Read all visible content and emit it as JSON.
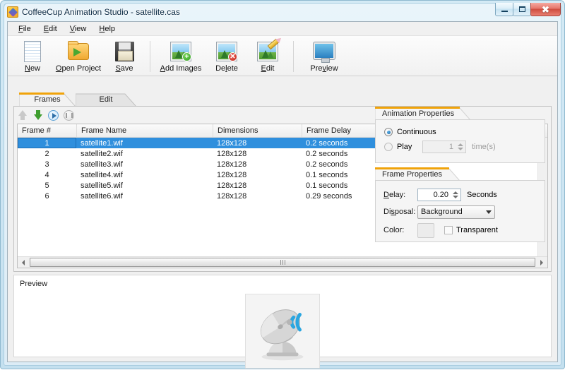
{
  "window": {
    "title": "CoffeeCup Animation Studio - satellite.cas",
    "app_icon": "coffeecup-app-icon",
    "buttons": {
      "minimize": "–",
      "maximize": "□",
      "close": "✕"
    }
  },
  "menu": {
    "items": [
      {
        "label": "File",
        "accel": "F"
      },
      {
        "label": "Edit",
        "accel": "E"
      },
      {
        "label": "View",
        "accel": "V"
      },
      {
        "label": "Help",
        "accel": "H"
      }
    ]
  },
  "toolbar": {
    "buttons": [
      {
        "label": "New",
        "accel": "N",
        "icon": "new-document-icon"
      },
      {
        "label": "Open Project",
        "accel": "O",
        "icon": "open-folder-icon"
      },
      {
        "label": "Save",
        "accel": "S",
        "icon": "floppy-disk-icon"
      },
      {
        "label": "Add Images",
        "accel": "A",
        "icon": "add-image-icon"
      },
      {
        "label": "Delete",
        "accel": "l",
        "icon": "delete-image-icon"
      },
      {
        "label": "Edit",
        "accel": "E",
        "icon": "edit-image-icon"
      },
      {
        "label": "Preview",
        "accel": "v",
        "icon": "monitor-preview-icon"
      }
    ]
  },
  "tabs": [
    {
      "label": "Frames",
      "active": true
    },
    {
      "label": "Edit",
      "active": false
    }
  ],
  "list_tools": [
    {
      "name": "move-up-button",
      "icon": "arrow-up-icon",
      "enabled": false
    },
    {
      "name": "move-down-button",
      "icon": "arrow-down-icon",
      "enabled": true
    },
    {
      "name": "play-button",
      "icon": "play-icon",
      "enabled": true
    },
    {
      "name": "pause-button",
      "icon": "pause-icon",
      "enabled": false
    }
  ],
  "frame_list": {
    "columns": [
      "Frame #",
      "Frame Name",
      "Dimensions",
      "Frame Delay"
    ],
    "rows": [
      {
        "num": "1",
        "name": "satellite1.wif",
        "dimensions": "128x128",
        "delay": "0.2 seconds",
        "selected": true
      },
      {
        "num": "2",
        "name": "satellite2.wif",
        "dimensions": "128x128",
        "delay": "0.2 seconds",
        "selected": false
      },
      {
        "num": "3",
        "name": "satellite3.wif",
        "dimensions": "128x128",
        "delay": "0.2 seconds",
        "selected": false
      },
      {
        "num": "4",
        "name": "satellite4.wif",
        "dimensions": "128x128",
        "delay": "0.1 seconds",
        "selected": false
      },
      {
        "num": "5",
        "name": "satellite5.wif",
        "dimensions": "128x128",
        "delay": "0.1 seconds",
        "selected": false
      },
      {
        "num": "6",
        "name": "satellite6.wif",
        "dimensions": "128x128",
        "delay": "0.29 seconds",
        "selected": false
      }
    ]
  },
  "animation_properties": {
    "title": "Animation Properties",
    "continuous_label": "Continuous",
    "continuous_selected": true,
    "play_label": "Play",
    "play_selected": false,
    "play_count": "1",
    "times_label": "time(s)"
  },
  "frame_properties": {
    "title": "Frame Properties",
    "delay_label": "Delay:",
    "delay_accel": "D",
    "delay_value": "0.20",
    "seconds_label": "Seconds",
    "disposal_label": "Disposal:",
    "disposal_accel": "s",
    "disposal_value": "Background",
    "disposal_options": [
      "Background"
    ],
    "color_label": "Color:",
    "color_value": "#ececec",
    "transparent_label": "Transparent",
    "transparent_checked": false
  },
  "preview": {
    "label": "Preview",
    "image_alt": "satellite-dish-image"
  },
  "colors": {
    "accent_orange": "#f0a30a",
    "selection_blue": "#2f8fdd",
    "titlebar_glass": "#d4eaf5",
    "close_red": "#cf4c3e"
  }
}
